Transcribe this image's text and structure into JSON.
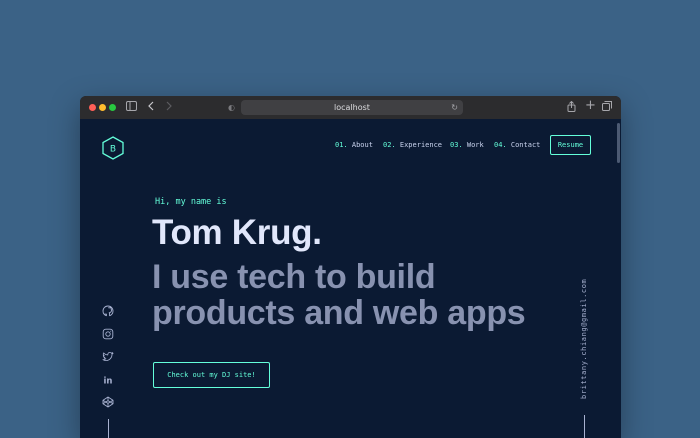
{
  "browser": {
    "url": "localhost",
    "colors": {
      "close": "#ff5f57",
      "minimize": "#febc2e",
      "zoom": "#28c840"
    }
  },
  "site": {
    "logo_letter": "B",
    "nav": [
      {
        "num": "01.",
        "label": "About"
      },
      {
        "num": "02.",
        "label": "Experience"
      },
      {
        "num": "03.",
        "label": "Work"
      },
      {
        "num": "04.",
        "label": "Contact"
      }
    ],
    "resume_label": "Resume",
    "intro": "Hi, my name is",
    "name": "Tom Krug.",
    "tagline_line1": "I use tech to build",
    "tagline_line2": "products and web apps",
    "cta_label": "Check out my DJ site!",
    "email": "brittany.chiang@gmail.com",
    "social_icons": [
      "github-icon",
      "instagram-icon",
      "twitter-icon",
      "linkedin-icon",
      "codepen-icon"
    ],
    "accent_color": "#64ffda",
    "background_color": "#0b1a33"
  }
}
